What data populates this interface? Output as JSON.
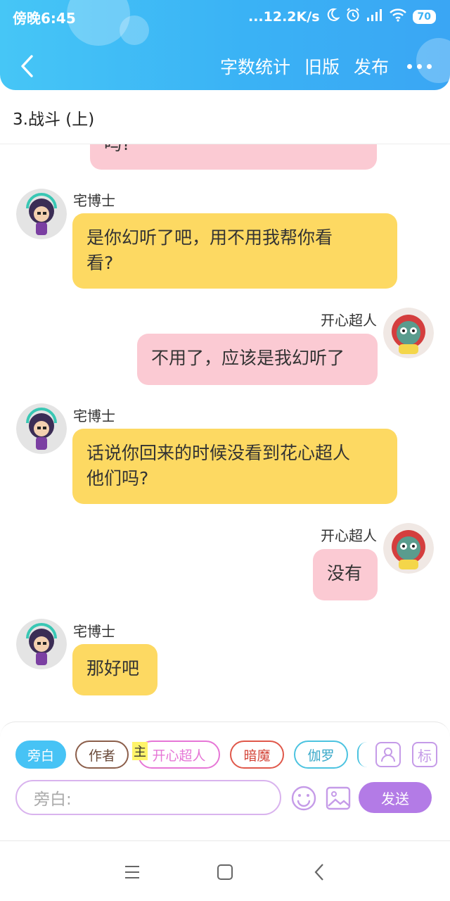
{
  "status_bar": {
    "time": "傍晚6:45",
    "network_speed": "...12.2K/s",
    "battery": "70"
  },
  "header": {
    "back_icon": "chevron-left-icon",
    "word_count": "字数统计",
    "old_version": "旧版",
    "publish": "发布",
    "more_icon": "more-dots-icon"
  },
  "chapter": {
    "title": "3.战斗 (上)"
  },
  "messages": [
    {
      "side": "right",
      "sender": "",
      "text": "吗?",
      "partial": true
    },
    {
      "side": "left",
      "sender": "宅博士",
      "lines": [
        "是你幻听了吧，用不用我帮你看",
        "看?"
      ]
    },
    {
      "side": "right",
      "sender": "开心超人",
      "lines": [
        "不用了，应该是我幻听了"
      ]
    },
    {
      "side": "left",
      "sender": "宅博士",
      "lines": [
        "话说你回来的时候没看到花心超人",
        "他们吗?"
      ]
    },
    {
      "side": "right",
      "sender": "开心超人",
      "lines": [
        "没有"
      ]
    },
    {
      "side": "left",
      "sender": "宅博士",
      "lines": [
        "那好吧"
      ]
    }
  ],
  "colors": {
    "header_blue": "#3ab2f5",
    "left_bubble": "#fdd962",
    "right_bubble": "#fbcad3",
    "send_purple": "#b37be6"
  },
  "roles": [
    {
      "label": "旁白",
      "selected": true,
      "color": "#47c3f5"
    },
    {
      "label": "作者",
      "selected": false,
      "color": "#8b5e4a"
    },
    {
      "label": "开心超人",
      "selected": false,
      "color": "#e676d6"
    },
    {
      "label": "暗魔",
      "selected": false,
      "color": "#e0584a"
    },
    {
      "label": "伽罗",
      "selected": false,
      "color": "#4cc3e0"
    }
  ],
  "host_tag": "主",
  "side_buttons": {
    "character_icon": "character-card-icon",
    "tag_label": "标"
  },
  "input": {
    "placeholder": "旁白:",
    "emoji_icon": "smiley-icon",
    "image_icon": "image-icon",
    "send_label": "发送"
  },
  "system_nav": {
    "menu_icon": "menu-icon",
    "home_icon": "home-square-icon",
    "back_icon": "back-triangle-icon"
  }
}
